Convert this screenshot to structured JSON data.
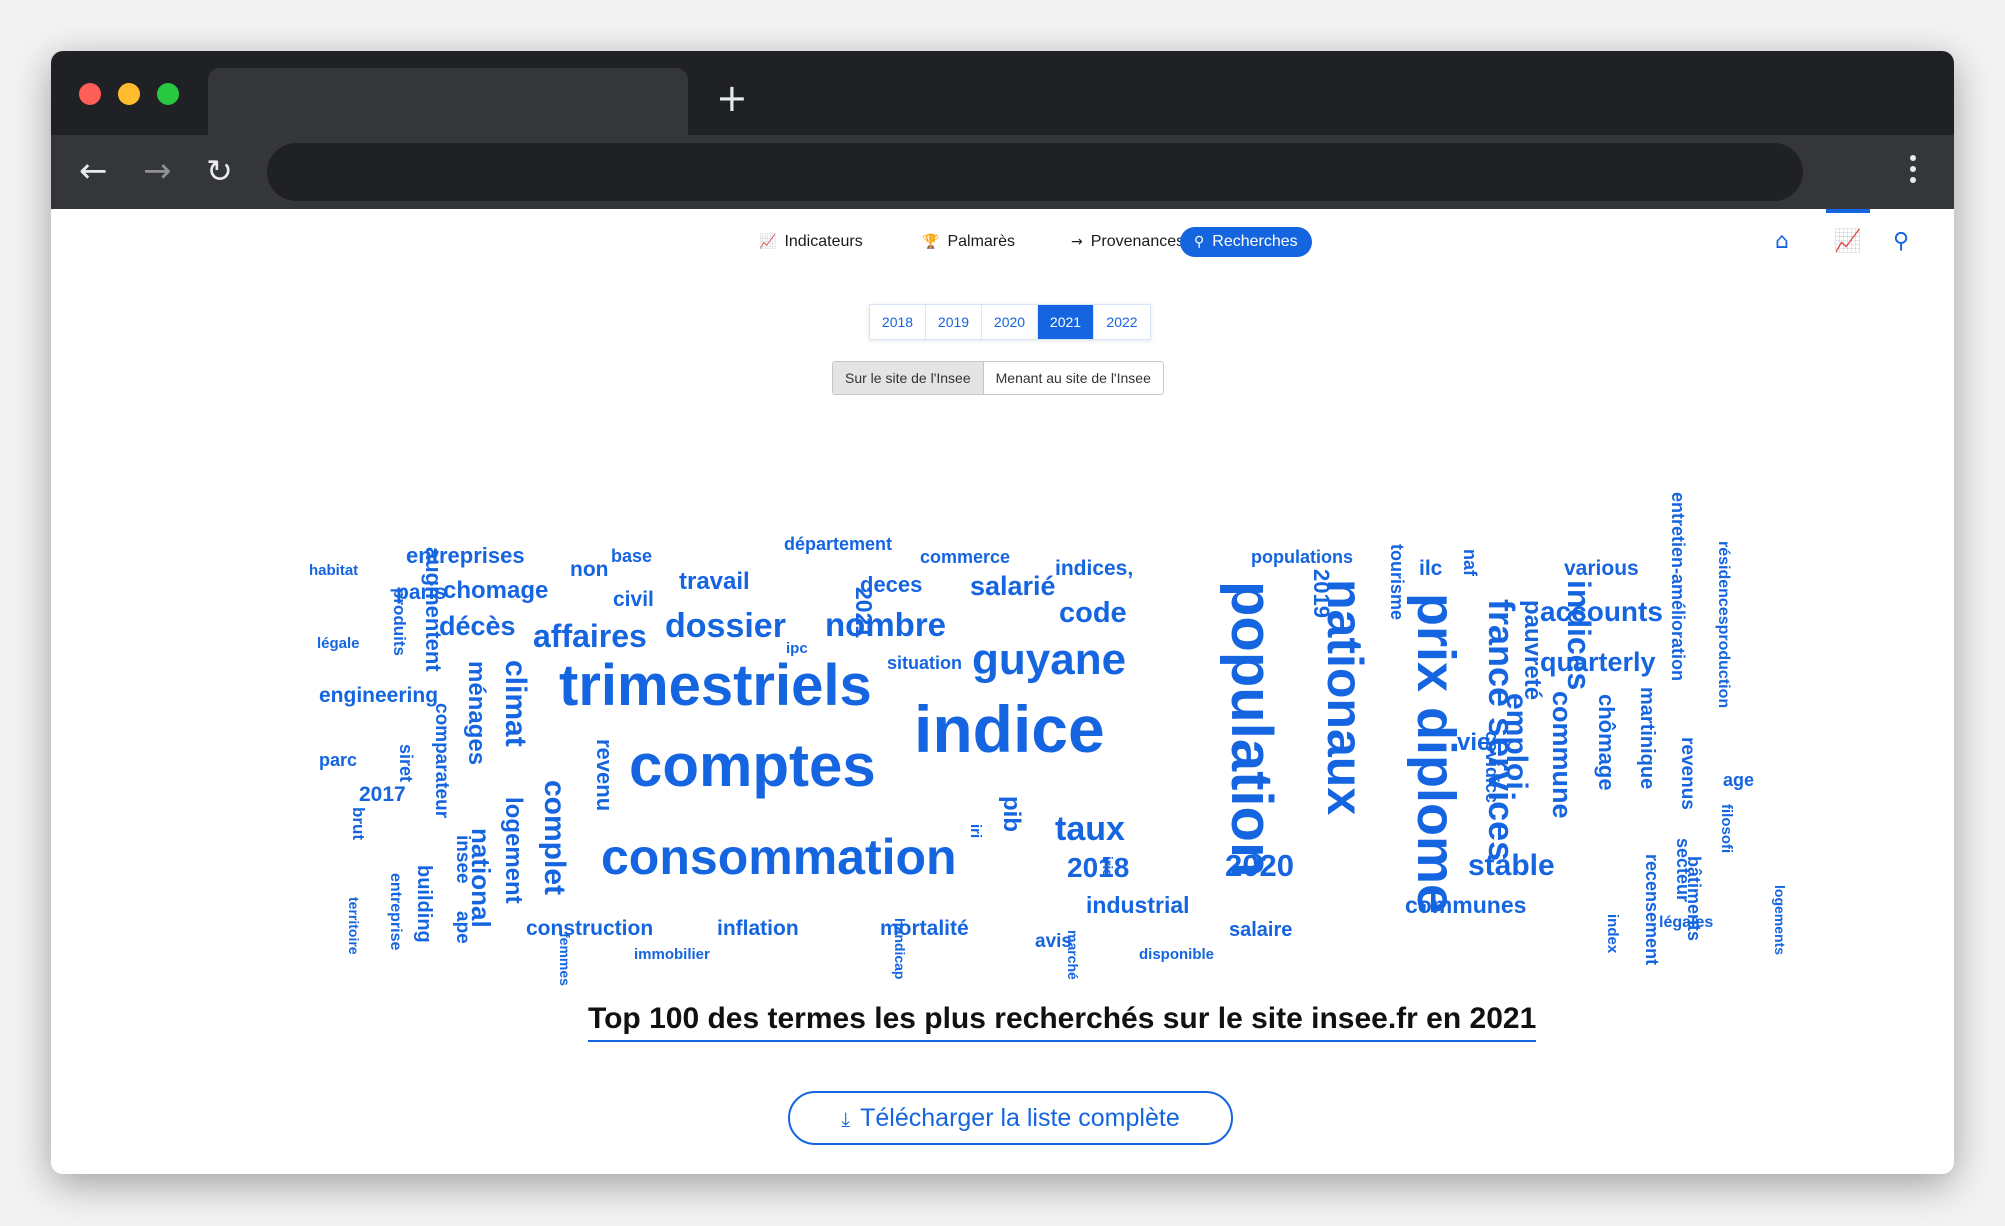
{
  "browser": {
    "new_tab_icon": "+",
    "back_icon": "arrow-left-icon",
    "forward_icon": "arrow-right-icon",
    "reload_icon": "reload-icon"
  },
  "nav": {
    "items": [
      {
        "label": "Indicateurs",
        "icon": "chart-line-icon"
      },
      {
        "label": "Palmarès",
        "icon": "trophy-icon"
      },
      {
        "label": "Provenances",
        "icon": "arrow-right-icon"
      },
      {
        "label": "Recherches",
        "icon": "binoculars-icon"
      }
    ],
    "active": "Recherches"
  },
  "years": [
    "2018",
    "2019",
    "2020",
    "2021",
    "2022"
  ],
  "selected_year": "2021",
  "scope": {
    "options": [
      "Sur le site de l'Insee",
      "Menant au site de l'Insee"
    ],
    "selected": "Sur le site de l'Insee"
  },
  "cloud": {
    "words": [
      "habitat",
      "augmentent",
      "entreprises",
      "non",
      "base",
      "département",
      "commerce",
      "indices,",
      "populations",
      "tourisme",
      "ilc",
      "naf",
      "various",
      "entretien-amélioration",
      "résidencesproduction",
      "produits",
      "paris",
      "chomage",
      "travail",
      "deces",
      "salarié",
      "2019",
      "indices",
      "accounts",
      "légale",
      "décès",
      "civil",
      "2021",
      "dossier",
      "nombre",
      "code",
      "population",
      "nationaux",
      "prix diplome",
      "france services",
      "pauvreté",
      "quarterly",
      "affaires",
      "ipc",
      "situation",
      "guyane",
      "trimestriels",
      "engineering",
      "ménages",
      "climat",
      "indice",
      "vie",
      "emploi",
      "commune",
      "chômage",
      "martinique",
      "revenus",
      "age",
      "parc",
      "siret",
      "comparateur",
      "revenu",
      "covidicc",
      "2017",
      "brut",
      "complet",
      "comptes",
      "logement",
      "pib",
      "iri",
      "taux",
      "stable",
      "filosofi",
      "national",
      "consommation",
      "2018",
      "2020",
      "secteur",
      "building",
      "insee",
      "ape",
      "iris",
      "industrial",
      "communes",
      "recensement",
      "bâtiments",
      "légales",
      "logements",
      "entreprise",
      "construction",
      "inflation",
      "mortalité",
      "avis",
      "salaire",
      "territoire",
      "immobilier",
      "handicap",
      "marché",
      "disponible",
      "femmes",
      "index"
    ]
  },
  "cloud_title": "Top 100 des termes les plus recherchés sur le site insee.fr en 2021",
  "download_label": "Télécharger la liste complète",
  "download_icon": "download-icon",
  "right_icons": [
    "home-icon",
    "chart-icon",
    "search-icon"
  ]
}
